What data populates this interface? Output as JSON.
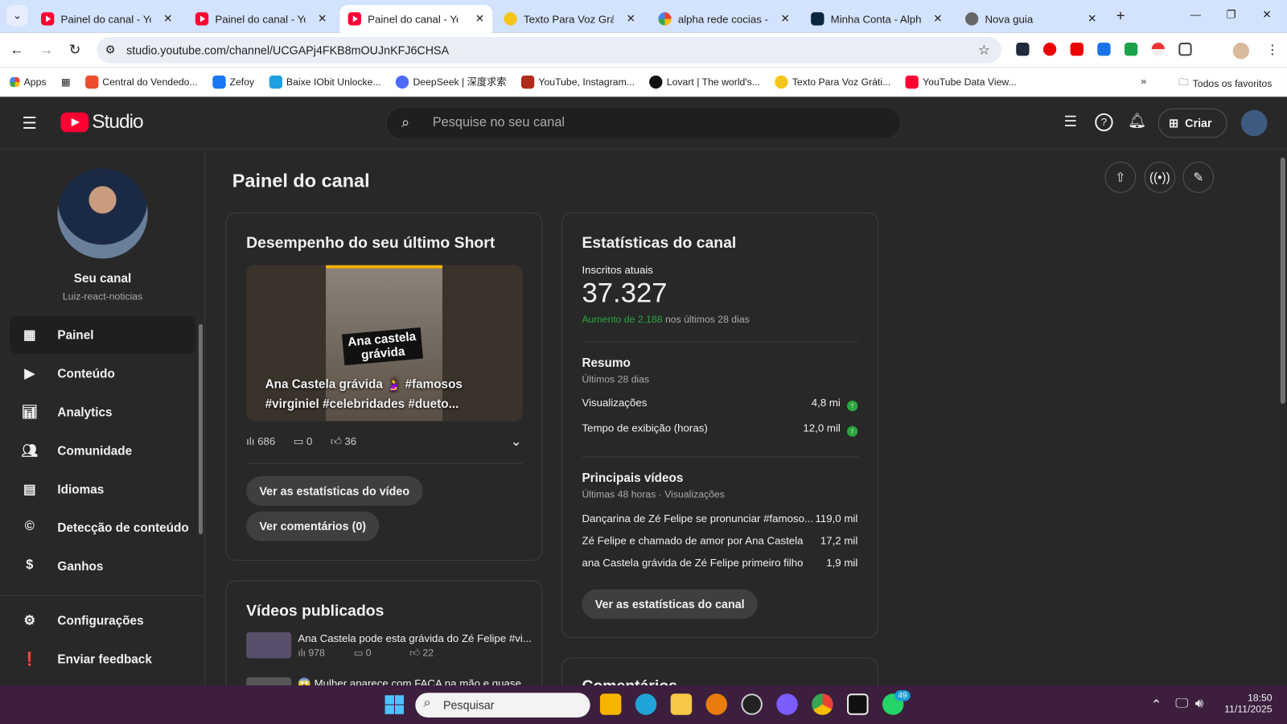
{
  "browser": {
    "tabs": [
      {
        "title": "Painel do canal - YouTu",
        "icon": "youtube-icon"
      },
      {
        "title": "Painel do canal - YouTu",
        "icon": "youtube-icon"
      },
      {
        "title": "Painel do canal - YouTu",
        "icon": "youtube-icon",
        "active": true
      },
      {
        "title": "Texto Para Voz Grátis O",
        "icon": "tts-icon"
      },
      {
        "title": "alpha rede cocias - Goo",
        "icon": "google-icon"
      },
      {
        "title": "Minha Conta - Alpha",
        "icon": "alpha-icon"
      },
      {
        "title": "Nova guia",
        "icon": "chrome-icon"
      }
    ],
    "url": "studio.youtube.com/channel/UCGAPj4FKB8mOUJnKFJ6CHSA",
    "bookmarks": [
      "Apps",
      "Central do Vendedo...",
      "Zefoy",
      "Baixe IObit Unlocke...",
      "DeepSeek | 深度求索",
      "YouTube, Instagram...",
      "Lovart | The world's...",
      "Texto Para Voz Gráti...",
      "YouTube Data View..."
    ],
    "all_bookmarks": "Todos os favoritos"
  },
  "header": {
    "logo": "Studio",
    "search_placeholder": "Pesquise no seu canal",
    "create": "Criar"
  },
  "sidebar": {
    "channel_label": "Seu canal",
    "channel_name": "Luiz-react-noticias",
    "items": [
      "Painel",
      "Conteúdo",
      "Analytics",
      "Comunidade",
      "Idiomas",
      "Detecção de conteúdo",
      "Ganhos"
    ],
    "bottom": [
      "Configurações",
      "Enviar feedback"
    ]
  },
  "page_title": "Painel do canal",
  "short": {
    "title": "Desempenho do seu último Short",
    "thumb_overlay": "Ana castela grávida",
    "caption": "Ana Castela grávida 🤰 #famosos #virginiel #celebridades #dueto...",
    "views": "686",
    "comments": "0",
    "likes": "36",
    "btn_stats": "Ver as estatísticas do vídeo",
    "btn_comments": "Ver comentários (0)"
  },
  "published": {
    "title": "Vídeos publicados",
    "videos": [
      {
        "title": "Ana Castela pode esta grávida do Zé Felipe #vi...",
        "views": "978",
        "comments": "0",
        "likes": "22"
      },
      {
        "title": "😱 Mulher aparece com FACA na mão e quase..."
      }
    ]
  },
  "stats": {
    "title": "Estatísticas do canal",
    "subs_label": "Inscritos atuais",
    "subs": "37.327",
    "increase": "Aumento de 2.188",
    "increase_suffix": "nos últimos 28 dias",
    "summary_title": "Resumo",
    "summary_period": "Últimos 28 dias",
    "summary": [
      {
        "label": "Visualizações",
        "value": "4,8 mi"
      },
      {
        "label": "Tempo de exibição (horas)",
        "value": "12,0 mil"
      }
    ],
    "top_title": "Principais vídeos",
    "top_period": "Últimas 48 horas · Visualizações",
    "top": [
      {
        "label": "Dançarina de Zé Felipe se pronunciar #famoso...",
        "value": "119,0 mil"
      },
      {
        "label": "Zé Felipe e chamado de amor por Ana Castela",
        "value": "17,2 mil"
      },
      {
        "label": "ana Castela grávida de Zé Felipe primeiro filho",
        "value": "1,9 mil"
      }
    ],
    "btn": "Ver as estatísticas do canal"
  },
  "comments_card": {
    "title": "Comentários"
  },
  "taskbar": {
    "search": "Pesquisar",
    "time": "18:50",
    "date": "11/11/2025",
    "whatsapp_badge": "49"
  },
  "colors": {
    "accent": "#ff0033",
    "positive": "#2ba640",
    "bg": "#282828"
  }
}
